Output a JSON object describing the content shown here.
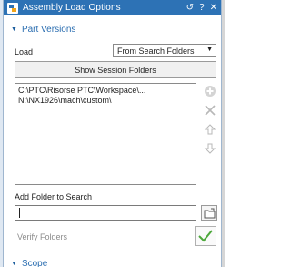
{
  "dialog": {
    "title": "Assembly Load Options",
    "controls": {
      "reset": "↺",
      "help": "?",
      "close": "✕"
    }
  },
  "part_versions": {
    "header": "Part Versions",
    "load_label": "Load",
    "load_value": "From Search Folders",
    "show_session_folders": "Show Session Folders",
    "folders": [
      "C:\\PTC\\Risorse PTC\\Workspace\\...",
      "N:\\NX1926\\mach\\custom\\"
    ],
    "add_folder_label": "Add Folder to Search",
    "add_folder_value": "",
    "verify_label": "Verify Folders"
  },
  "scope": {
    "header": "Scope"
  },
  "colors": {
    "titlebar": "#2d72b5",
    "accent_text": "#2a6db0",
    "ok_check": "#4ca83a"
  }
}
